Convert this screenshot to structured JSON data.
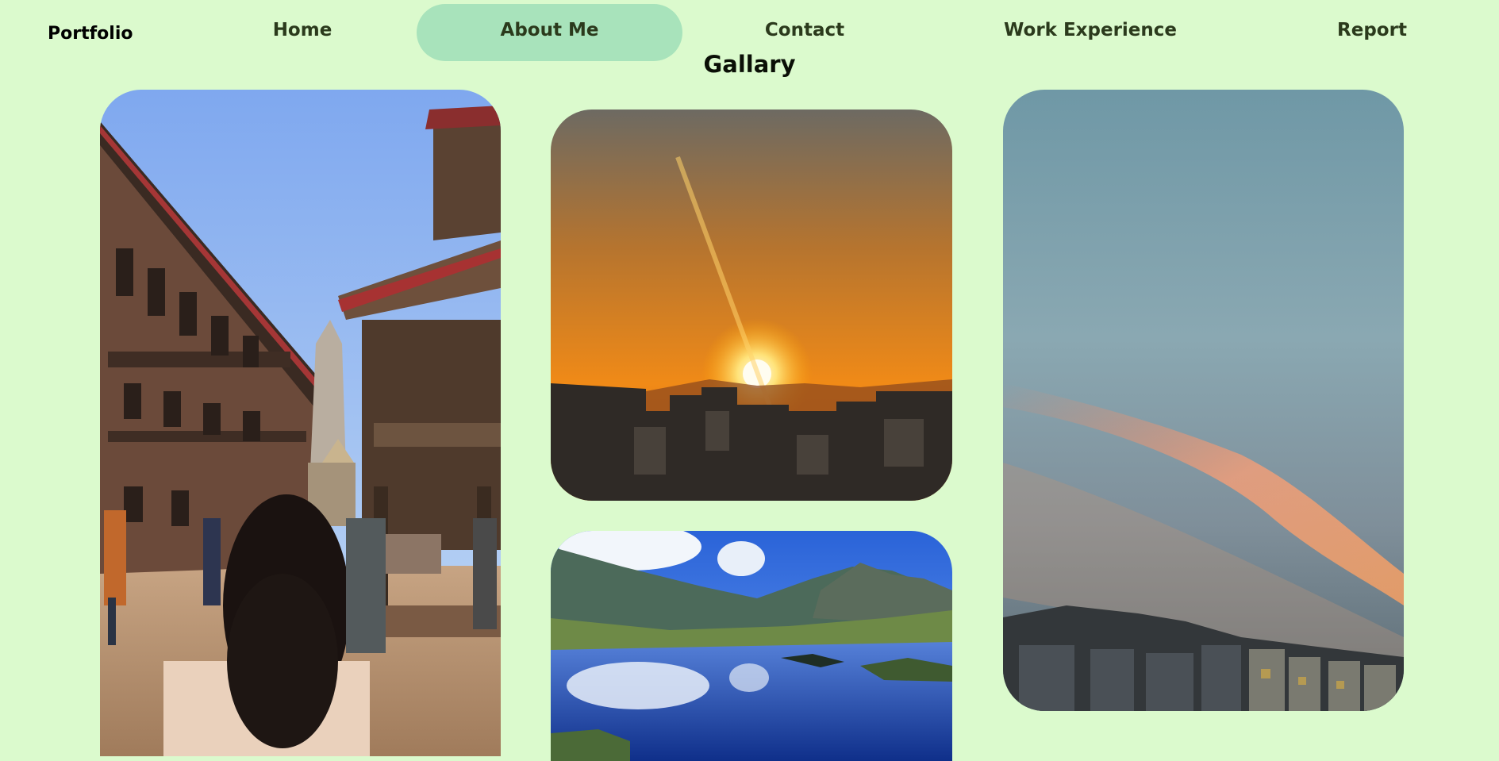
{
  "nav": {
    "brand": "Portfolio",
    "items": [
      {
        "label": "Home",
        "active": false
      },
      {
        "label": "About Me",
        "active": true
      },
      {
        "label": "Contact",
        "active": false
      },
      {
        "label": "Work Experience",
        "active": false
      },
      {
        "label": "Report",
        "active": false
      }
    ]
  },
  "gallery": {
    "title": "Gallary",
    "photos": [
      {
        "subject": "temple-square"
      },
      {
        "subject": "sunset-over-city"
      },
      {
        "subject": "mountain-lake"
      },
      {
        "subject": "evening-sky"
      }
    ]
  },
  "colors": {
    "background": "#dbfacd",
    "nav_active": "#a8e3bb",
    "nav_text": "#2b3a1c"
  }
}
